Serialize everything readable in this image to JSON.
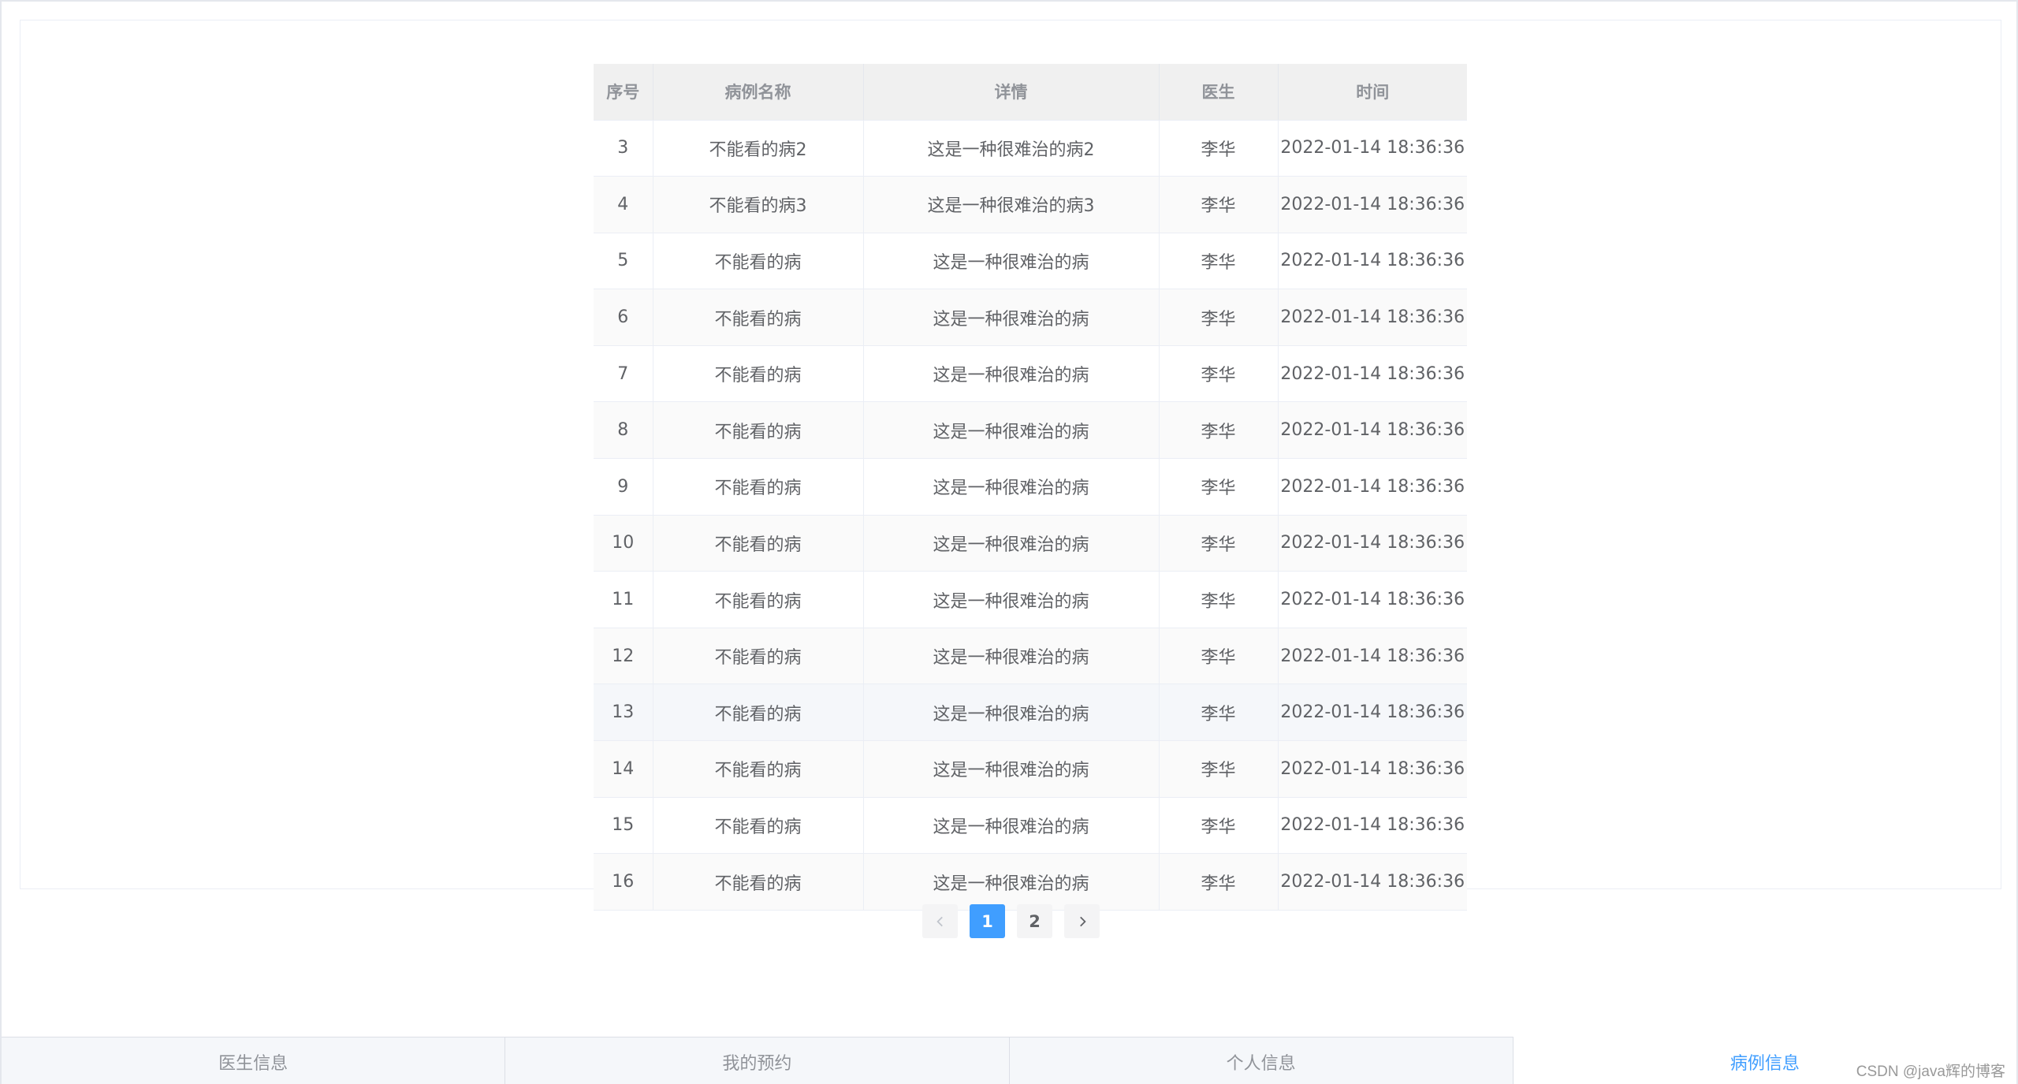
{
  "table": {
    "headers": [
      "序号",
      "病例名称",
      "详情",
      "医生",
      "时间"
    ],
    "rows": [
      [
        "3",
        "不能看的病2",
        "这是一种很难治的病2",
        "李华",
        "2022-01-14 18:36:36"
      ],
      [
        "4",
        "不能看的病3",
        "这是一种很难治的病3",
        "李华",
        "2022-01-14 18:36:36"
      ],
      [
        "5",
        "不能看的病",
        "这是一种很难治的病",
        "李华",
        "2022-01-14 18:36:36"
      ],
      [
        "6",
        "不能看的病",
        "这是一种很难治的病",
        "李华",
        "2022-01-14 18:36:36"
      ],
      [
        "7",
        "不能看的病",
        "这是一种很难治的病",
        "李华",
        "2022-01-14 18:36:36"
      ],
      [
        "8",
        "不能看的病",
        "这是一种很难治的病",
        "李华",
        "2022-01-14 18:36:36"
      ],
      [
        "9",
        "不能看的病",
        "这是一种很难治的病",
        "李华",
        "2022-01-14 18:36:36"
      ],
      [
        "10",
        "不能看的病",
        "这是一种很难治的病",
        "李华",
        "2022-01-14 18:36:36"
      ],
      [
        "11",
        "不能看的病",
        "这是一种很难治的病",
        "李华",
        "2022-01-14 18:36:36"
      ],
      [
        "12",
        "不能看的病",
        "这是一种很难治的病",
        "李华",
        "2022-01-14 18:36:36"
      ],
      [
        "13",
        "不能看的病",
        "这是一种很难治的病",
        "李华",
        "2022-01-14 18:36:36"
      ],
      [
        "14",
        "不能看的病",
        "这是一种很难治的病",
        "李华",
        "2022-01-14 18:36:36"
      ],
      [
        "15",
        "不能看的病",
        "这是一种很难治的病",
        "李华",
        "2022-01-14 18:36:36"
      ],
      [
        "16",
        "不能看的病",
        "这是一种很难治的病",
        "李华",
        "2022-01-14 18:36:36"
      ]
    ],
    "hover_row_index": 10
  },
  "pagination": {
    "prev_icon": "chevron-left-icon",
    "pages": [
      "1",
      "2"
    ],
    "current_page": "1",
    "next_icon": "chevron-right-icon"
  },
  "tabbar": {
    "tabs": [
      "医生信息",
      "我的预约",
      "个人信息",
      "病例信息"
    ],
    "active_tab": "病例信息"
  },
  "colors": {
    "accent": "#409eff",
    "header_bg": "#f0f0f0",
    "text": "#606266",
    "muted": "#909399"
  },
  "watermark": "CSDN @java辉的博客"
}
